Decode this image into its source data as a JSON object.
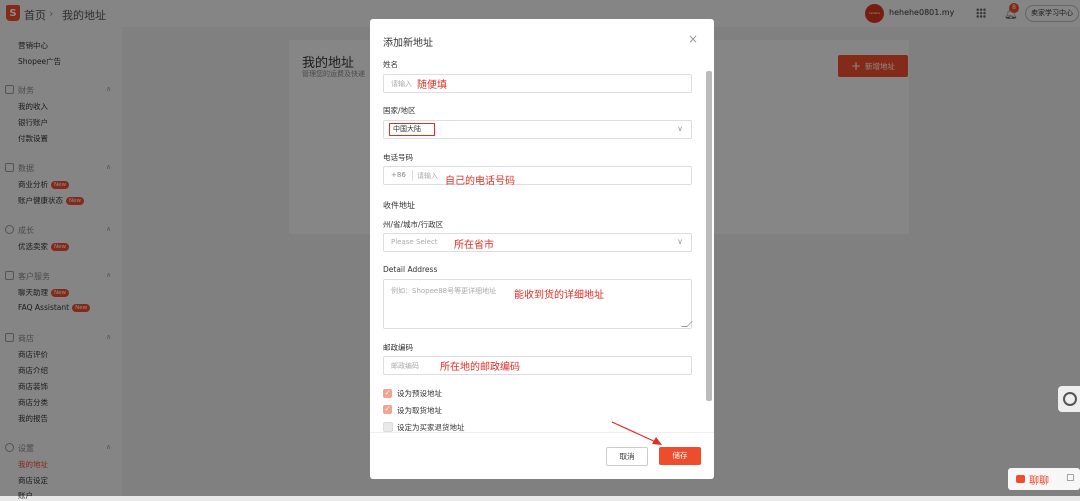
{
  "topbar": {
    "logo_glyph": "S",
    "breadcrumb_home": "首页",
    "breadcrumb_sep": "›",
    "breadcrumb_current": "我的地址",
    "avatar_text": "hehehe",
    "account_name": "hehehe0801.my",
    "notification_count": "8",
    "learn_center": "卖家学习中心"
  },
  "sidebar": {
    "marketing_items": [
      "营销中心",
      "Shopee广告"
    ],
    "finance": {
      "title": "财务",
      "items": [
        "我的收入",
        "银行账户",
        "付款设置"
      ]
    },
    "data": {
      "title": "数据",
      "items": [
        "商业分析",
        "账户健康状态"
      ]
    },
    "growth": {
      "title": "成长",
      "items": [
        "优选卖家"
      ]
    },
    "service": {
      "title": "客户服务",
      "items": [
        "聊天助理",
        "FAQ Assistant"
      ]
    },
    "shop": {
      "title": "商店",
      "items": [
        "商店评价",
        "商店介绍",
        "商店装饰",
        "商店分类",
        "我的报告"
      ]
    },
    "settings": {
      "title": "设置",
      "items": [
        "我的地址",
        "商店设定",
        "账户"
      ]
    },
    "new_badge": "New",
    "chevron": "∧"
  },
  "main": {
    "title": "我的地址",
    "subtitle": "管理您的运费及快递",
    "add_button": "新增地址",
    "plus": "+"
  },
  "modal": {
    "title": "添加新地址",
    "close": "×",
    "name_label": "姓名",
    "name_placeholder": "请输入",
    "name_note": "随便填",
    "country_label": "国家/地区",
    "country_value": "中国大陆",
    "phone_label": "电话号码",
    "phone_prefix": "+86",
    "phone_placeholder": "请输入",
    "phone_note": "自己的电话号码",
    "section_title": "收件地址",
    "region_label": "州/省/城市/行政区",
    "region_placeholder": "Please Select",
    "region_note": "所在省市",
    "detail_label": "Detail Address",
    "detail_placeholder": "例如：Shopee88号等更详细地址",
    "detail_note": "能收到货的详细地址",
    "postal_label": "邮政编码",
    "postal_placeholder": "邮政编码",
    "postal_note": "所在地的邮政编码",
    "checkbox_default": "设为预设地址",
    "checkbox_pickup": "设为取货地址",
    "checkbox_return": "设定为买家退货地址",
    "check_mark": "✓",
    "chevron": "∨",
    "cancel": "取消",
    "save": "储存"
  },
  "float": {
    "chat": "聊聊",
    "collapse": "▢"
  },
  "colors": {
    "brand": "#ee4d2d",
    "annotation": "#e02e24"
  }
}
